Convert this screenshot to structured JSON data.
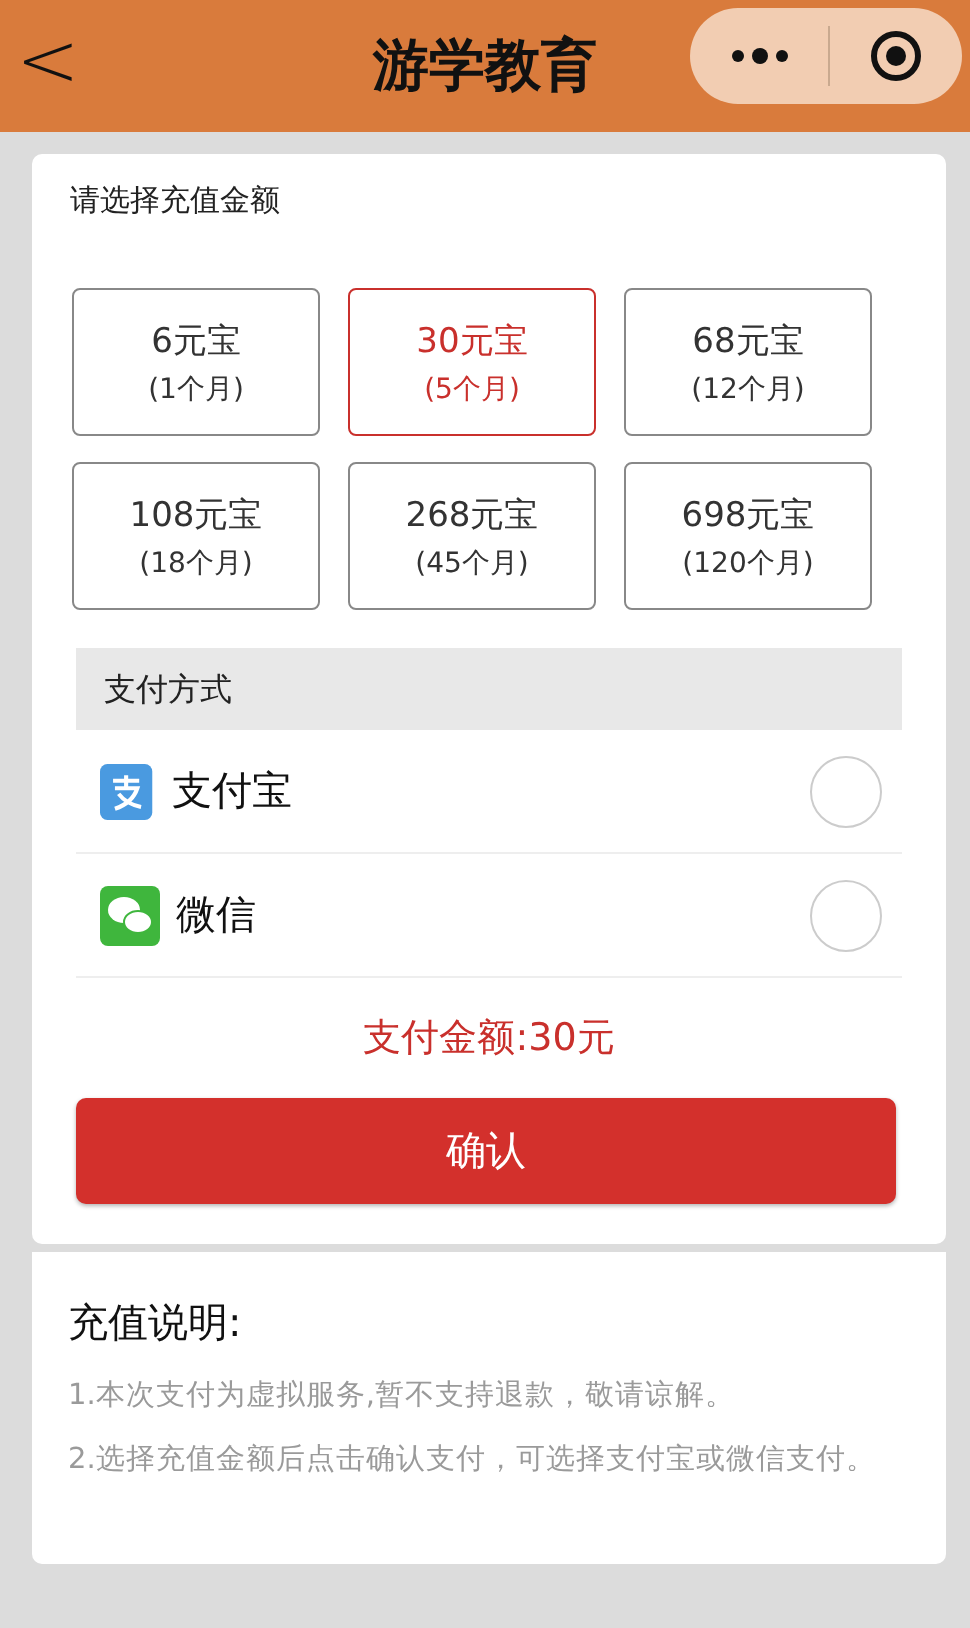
{
  "header": {
    "back": "<",
    "title": "游学教育"
  },
  "recharge": {
    "heading": "请选择充值金额",
    "options": [
      {
        "amount": "6元宝",
        "duration": "(1个月)",
        "selected": false
      },
      {
        "amount": "30元宝",
        "duration": "(5个月)",
        "selected": true
      },
      {
        "amount": "68元宝",
        "duration": "(12个月)",
        "selected": false
      },
      {
        "amount": "108元宝",
        "duration": "(18个月)",
        "selected": false
      },
      {
        "amount": "268元宝",
        "duration": "(45个月)",
        "selected": false
      },
      {
        "amount": "698元宝",
        "duration": "(120个月)",
        "selected": false
      }
    ]
  },
  "payment": {
    "heading": "支付方式",
    "methods": [
      {
        "kind": "alipay",
        "label": "支付宝",
        "selected": false
      },
      {
        "kind": "wechat",
        "label": "微信",
        "selected": false
      }
    ],
    "total": "支付金额:30元",
    "confirm": "确认"
  },
  "notes": {
    "heading": "充值说明:",
    "items": [
      "1.本次支付为虚拟服务,暂不支持退款，敬请谅解。",
      "2.选择充值金额后点击确认支付，可选择支付宝或微信支付。"
    ]
  }
}
